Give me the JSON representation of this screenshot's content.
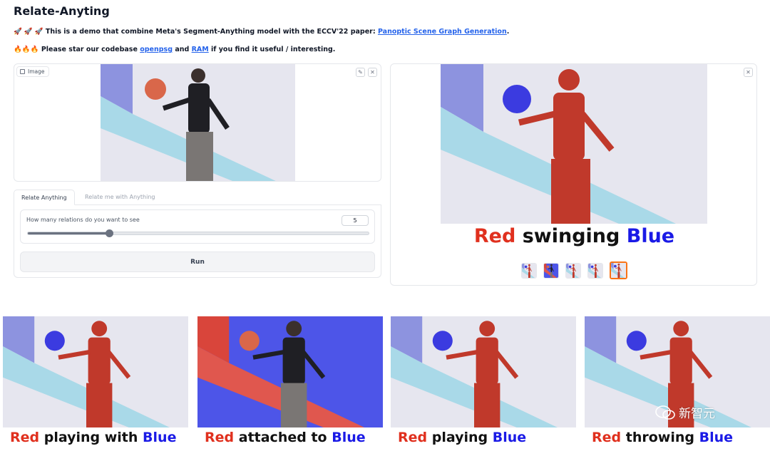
{
  "page": {
    "title": "Relate-Anyting",
    "line1": {
      "emoji": "🚀 🚀 🚀",
      "text": "This is a demo that combine Meta's Segment-Anything model with the ECCV'22 paper:",
      "link": "Panoptic Scene Graph Generation",
      "end": "."
    },
    "line2": {
      "emoji": "🔥🔥🔥",
      "text_a": "Please star our codebase",
      "link_a": "openpsg",
      "text_b": "and",
      "link_b": "RAM",
      "text_c": "if you find it useful / interesting."
    }
  },
  "input": {
    "label": "Image",
    "edit_icon": "pencil-icon",
    "close_icon": "close-icon"
  },
  "tabs": [
    "Relate Anything",
    "Relate me with Anything"
  ],
  "slider": {
    "label": "How many relations do you want to see",
    "value": "5",
    "fraction": 0.24
  },
  "run_button": "Run",
  "output": {
    "subject": "Red",
    "relation": "swinging",
    "object": "Blue",
    "gallery_count": 5,
    "selected_index": 4
  },
  "strip": [
    {
      "subject": "Red",
      "relation": "playing with",
      "object": "Blue"
    },
    {
      "subject": "Red",
      "relation": "attached to",
      "object": "Blue"
    },
    {
      "subject": "Red",
      "relation": "playing",
      "object": "Blue"
    },
    {
      "subject": "Red",
      "relation": "throwing",
      "object": "Blue"
    }
  ],
  "watermark": "新智元",
  "colors": {
    "red": "#e0301e",
    "blue": "#1a1ae6",
    "accent": "#2563eb",
    "selected": "#f97316"
  }
}
